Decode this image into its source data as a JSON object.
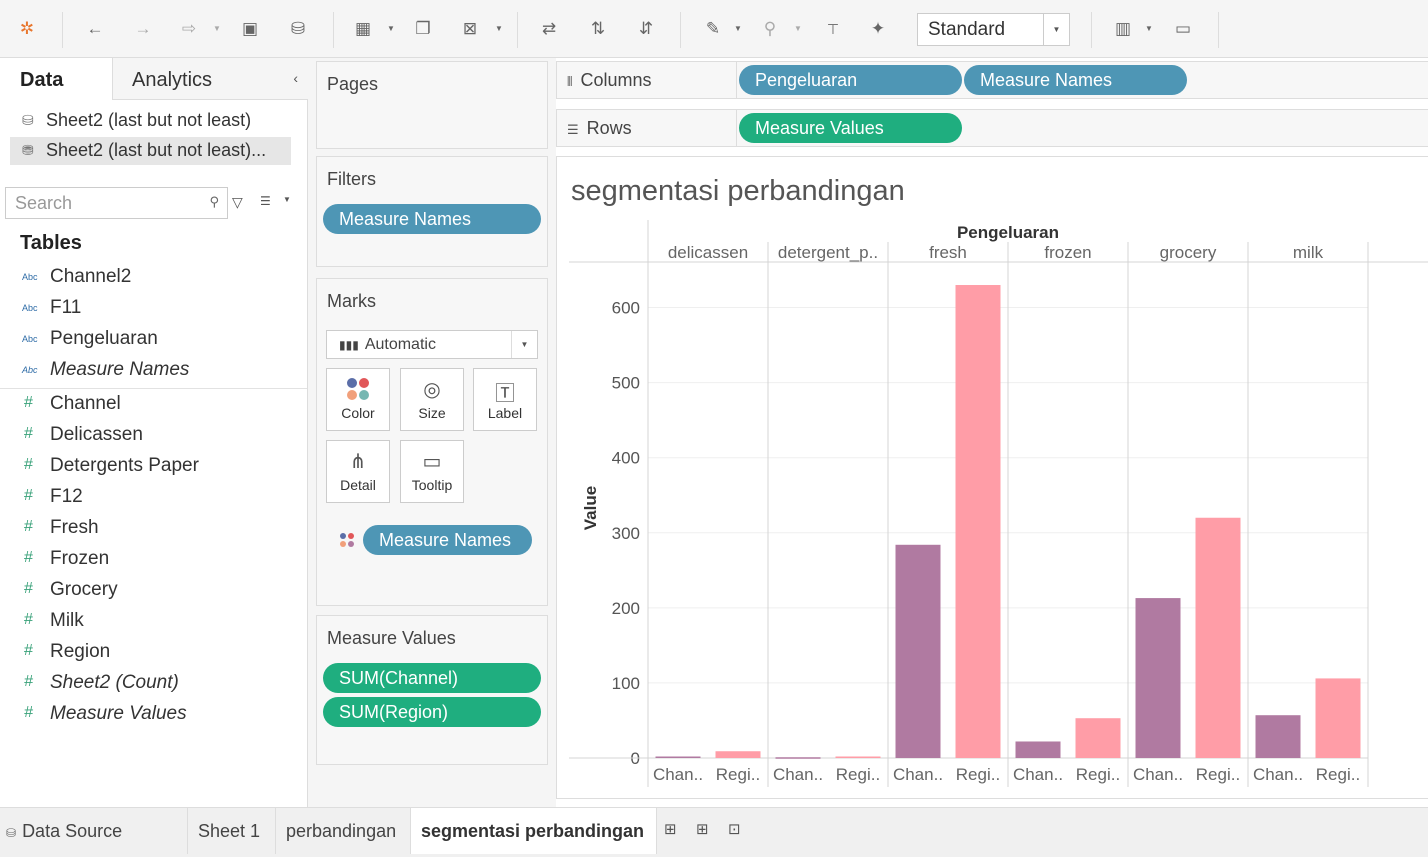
{
  "toolbar": {
    "icons": [
      "tableau-logo-icon",
      "undo-icon",
      "redo-icon",
      "replay-icon",
      "save-icon",
      "new-datasource-icon",
      "new-worksheet-icon",
      "duplicate-icon",
      "clear-sheet-icon",
      "swap-icon",
      "sort-ascending-icon",
      "sort-descending-icon",
      "highlight-icon",
      "group-icon",
      "show-labels-icon",
      "pin-icon",
      "show-me-icon",
      "presentation-icon"
    ],
    "fit_select": "Standard"
  },
  "datapane": {
    "tab_data": "Data",
    "tab_analytics": "Analytics",
    "datasources": [
      "Sheet2 (last but not least)",
      "Sheet2 (last but not least)..."
    ],
    "search_placeholder": "Search",
    "tables_heading": "Tables",
    "dimensions": [
      {
        "type": "Abc",
        "name": "Channel2"
      },
      {
        "type": "Abc",
        "name": "F11"
      },
      {
        "type": "Abc",
        "name": "Pengeluaran"
      },
      {
        "type": "Abc",
        "name": "Measure Names"
      }
    ],
    "measures": [
      {
        "type": "#",
        "name": "Channel"
      },
      {
        "type": "#",
        "name": "Delicassen"
      },
      {
        "type": "#",
        "name": "Detergents Paper"
      },
      {
        "type": "#",
        "name": "F12"
      },
      {
        "type": "#",
        "name": "Fresh"
      },
      {
        "type": "#",
        "name": "Frozen"
      },
      {
        "type": "#",
        "name": "Grocery"
      },
      {
        "type": "#",
        "name": "Milk"
      },
      {
        "type": "#",
        "name": "Region"
      },
      {
        "type": "#",
        "name": "Sheet2 (Count)"
      },
      {
        "type": "#",
        "name": "Measure Values"
      }
    ]
  },
  "cards": {
    "pages_title": "Pages",
    "filters_title": "Filters",
    "filters_pill": "Measure Names",
    "marks_title": "Marks",
    "marks_type": "Automatic",
    "marks_buttons": [
      "Color",
      "Size",
      "Label",
      "Detail",
      "Tooltip"
    ],
    "marks_pill": "Measure Names",
    "measure_values_title": "Measure Values",
    "measure_values_pills": [
      "SUM(Channel)",
      "SUM(Region)"
    ]
  },
  "shelves": {
    "columns_label": "Columns",
    "columns_pills": [
      "Pengeluaran",
      "Measure Names"
    ],
    "rows_label": "Rows",
    "rows_pills": [
      "Measure Values"
    ]
  },
  "view": {
    "title": "segmentasi perbandingan"
  },
  "chart_data": {
    "type": "bar",
    "header_title": "Pengeluaran",
    "ylabel": "Value",
    "ylim": [
      0,
      650
    ],
    "yticks": [
      0,
      100,
      200,
      300,
      400,
      500,
      600
    ],
    "groups": [
      "delicassen",
      "detergent_p..",
      "fresh",
      "frozen",
      "grocery",
      "milk"
    ],
    "sub_labels": [
      "Chan..",
      "Regi.."
    ],
    "series": [
      {
        "values": [
          2,
          1,
          284,
          22,
          213,
          57
        ],
        "color": "#b07aa1"
      },
      {
        "values": [
          9,
          2,
          630,
          53,
          320,
          106
        ],
        "color": "#ff9da7"
      }
    ]
  },
  "bottom_tabs": {
    "tabs": [
      "Data Source",
      "Sheet 1",
      "perbandingan",
      "segmentasi perbandingan"
    ],
    "active": "segmentasi perbandingan"
  }
}
